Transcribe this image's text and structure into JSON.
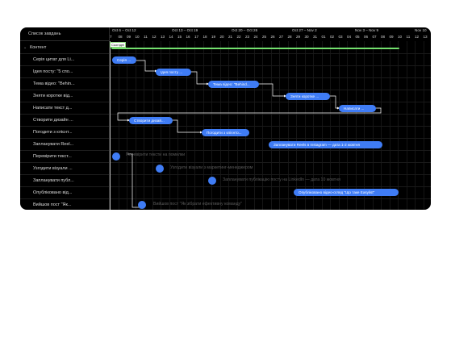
{
  "sidebar": {
    "header": "Список завдань",
    "group": "Контент",
    "items": [
      "Серія цитат для Li...",
      "Ідея посту: \"5 спо...",
      "Тема відео: \"Behin...",
      "Зняти коротке від...",
      "Написати текст д...",
      "Створити дизайн ...",
      "Погодити з клієнт...",
      "Запланувати Reel...",
      "Перевірити текст...",
      "Узгодити візуали ...",
      "Запланувати публ...",
      "Опубліковано від...",
      "Вийшов пост \"Як..."
    ]
  },
  "timeline": {
    "weeks": [
      "Oct 6 – Oct 12",
      "Oct 13 – Oct 19",
      "Oct 20 – Oct 26",
      "Oct 27 – Nov 2",
      "Nov 3 – Nov 9",
      "Nov 10"
    ],
    "days": [
      "7",
      "08",
      "09",
      "10",
      "11",
      "12",
      "13",
      "14",
      "15",
      "16",
      "17",
      "18",
      "19",
      "20",
      "21",
      "22",
      "23",
      "24",
      "25",
      "26",
      "27",
      "28",
      "29",
      "30",
      "31",
      "01",
      "02",
      "03",
      "04",
      "05",
      "06",
      "07",
      "08",
      "09",
      "10",
      "11",
      "12",
      "13"
    ],
    "today_label": "Сьогодні"
  },
  "tasks": [
    {
      "label": "Серія ..."
    },
    {
      "label": "Ідея посту ..."
    },
    {
      "label": "Тема відео: \"Behind..."
    },
    {
      "label": "Зняти коротке ..."
    },
    {
      "label": "Написати ..."
    },
    {
      "label": "Створити дизай..."
    },
    {
      "label": "Погодити з клієнто..."
    },
    {
      "label": "Запланувати Reels в Instagram — дата 1-2 жовтня"
    }
  ],
  "milestones": [
    {
      "label": "Перевірити тексти на помилки"
    },
    {
      "label": "Узгодити візуали з маркетинг-менеджером"
    },
    {
      "label": "Запланувати публікацію посту на LinkedIn — дата 10 жовтня"
    },
    {
      "label": "Опубліковано відео-огляд \"Що таке Easylist\""
    },
    {
      "label": "Вийшов пост \"Як зібрати ефективну команду\""
    }
  ],
  "colors": {
    "bar": "#3f7cf5",
    "progress": "#73e06e",
    "background": "#000000"
  }
}
